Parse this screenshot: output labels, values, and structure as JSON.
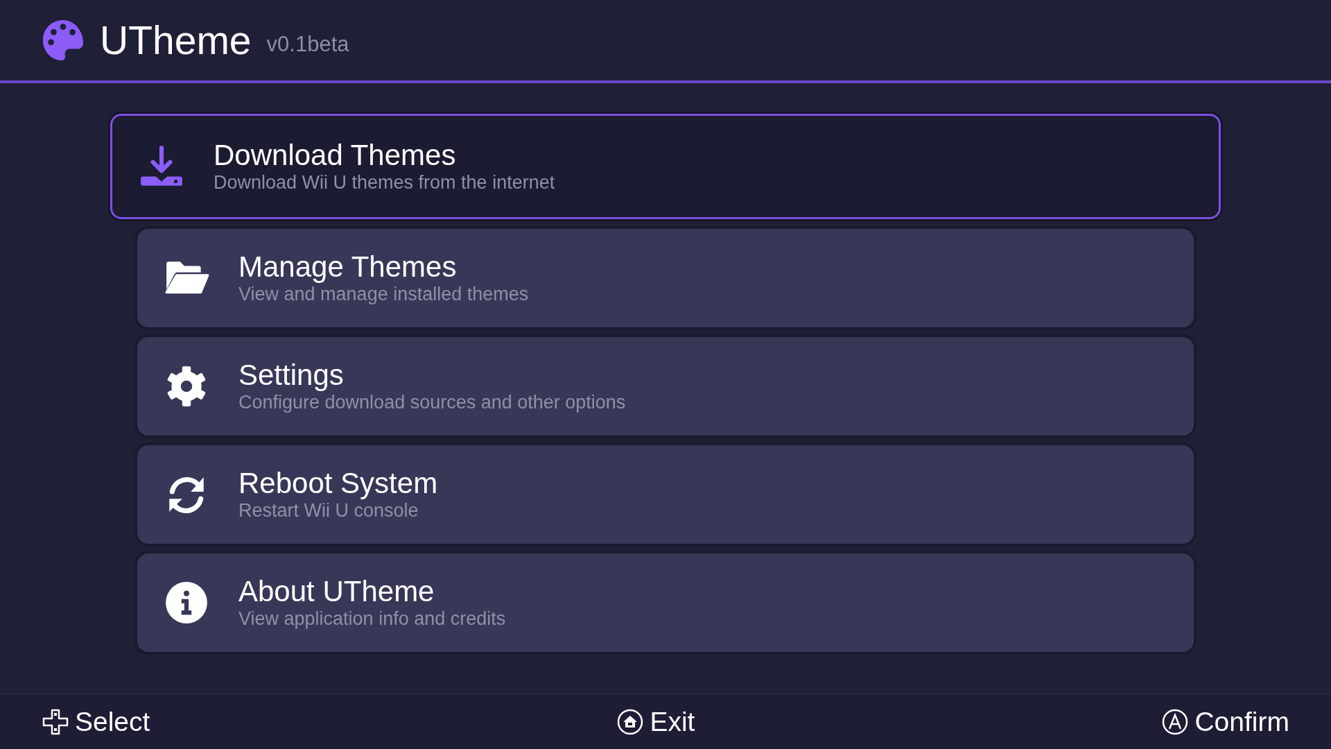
{
  "header": {
    "title": "UTheme",
    "version": "v0.1beta"
  },
  "menu": [
    {
      "kind": "download",
      "title": "Download Themes",
      "subtitle": "Download Wii U themes from the internet",
      "selected": true
    },
    {
      "kind": "folder",
      "title": "Manage Themes",
      "subtitle": "View and manage installed themes",
      "selected": false
    },
    {
      "kind": "settings",
      "title": "Settings",
      "subtitle": "Configure download sources and other options",
      "selected": false
    },
    {
      "kind": "reboot",
      "title": "Reboot System",
      "subtitle": "Restart Wii U console",
      "selected": false
    },
    {
      "kind": "info",
      "title": "About UTheme",
      "subtitle": "View application info and credits",
      "selected": false
    }
  ],
  "footer": [
    {
      "kind": "dpad",
      "label": "Select"
    },
    {
      "kind": "home",
      "label": "Exit"
    },
    {
      "kind": "a",
      "label": "Confirm"
    }
  ]
}
